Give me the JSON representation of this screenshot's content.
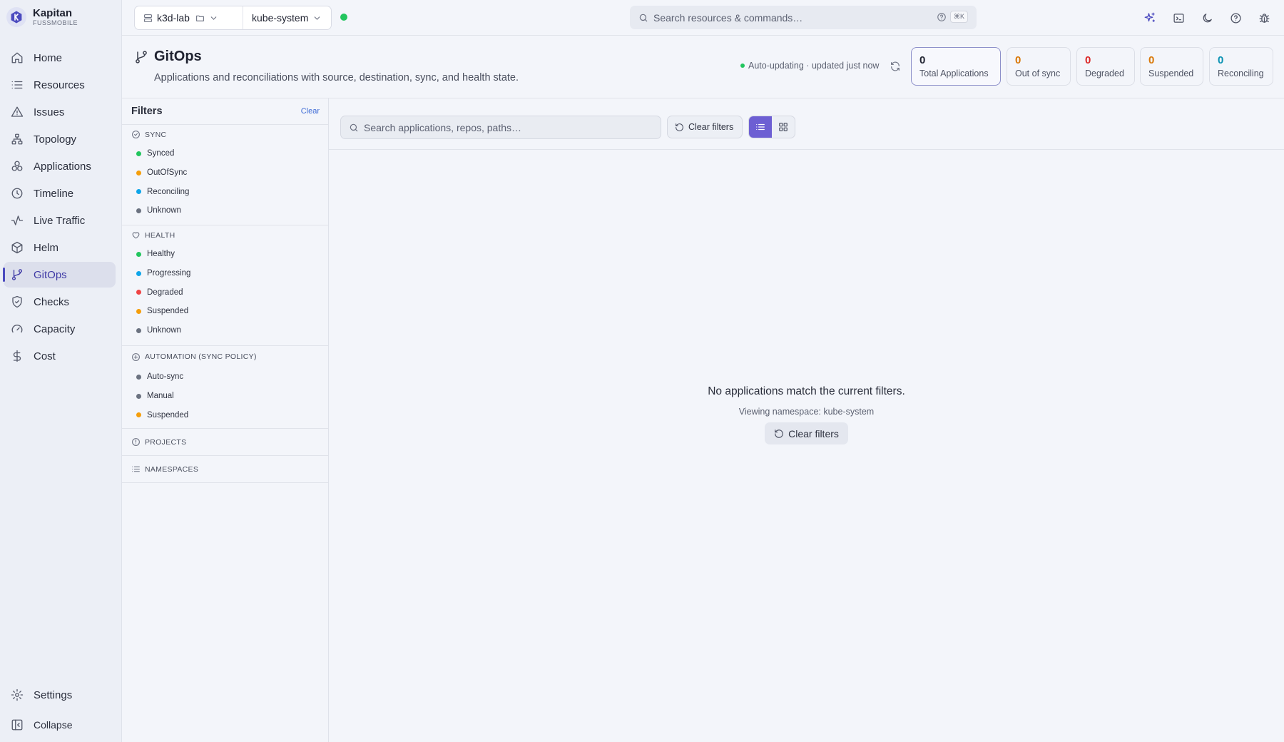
{
  "brand": {
    "name": "Kapitan",
    "subtitle": "FUSSMOBILE"
  },
  "nav": {
    "items": [
      {
        "label": "Home",
        "icon": "home-icon"
      },
      {
        "label": "Resources",
        "icon": "list-icon"
      },
      {
        "label": "Issues",
        "icon": "warning-icon"
      },
      {
        "label": "Topology",
        "icon": "topology-icon"
      },
      {
        "label": "Applications",
        "icon": "applications-icon"
      },
      {
        "label": "Timeline",
        "icon": "clock-icon"
      },
      {
        "label": "Live Traffic",
        "icon": "activity-icon"
      },
      {
        "label": "Helm",
        "icon": "package-icon"
      },
      {
        "label": "GitOps",
        "icon": "git-branch-icon",
        "active": true
      },
      {
        "label": "Checks",
        "icon": "shield-check-icon"
      },
      {
        "label": "Capacity",
        "icon": "gauge-icon"
      },
      {
        "label": "Cost",
        "icon": "dollar-icon"
      }
    ],
    "settings": "Settings",
    "collapse": "Collapse"
  },
  "topbar": {
    "cluster": "k3d-lab",
    "namespace": "kube-system",
    "connection_status_color": "#22c55e",
    "search_placeholder": "Search resources & commands…",
    "search_shortcut": "⌘K"
  },
  "header": {
    "title": "GitOps",
    "description": "Applications and reconciliations with source, destination, sync, and health state.",
    "auto_update_text": "Auto-updating · updated just now",
    "stats": [
      {
        "value": "0",
        "label": "Total Applications",
        "color": "#1f2230"
      },
      {
        "value": "0",
        "label": "Out of sync",
        "color": "#d97706"
      },
      {
        "value": "0",
        "label": "Degraded",
        "color": "#dc2626"
      },
      {
        "value": "0",
        "label": "Suspended",
        "color": "#d97706"
      },
      {
        "value": "0",
        "label": "Reconciling",
        "color": "#0891b2"
      }
    ]
  },
  "filters": {
    "title": "Filters",
    "clear": "Clear",
    "sync": {
      "title": "SYNC",
      "options": [
        {
          "label": "Synced",
          "color": "#22c55e"
        },
        {
          "label": "OutOfSync",
          "color": "#f59e0b"
        },
        {
          "label": "Reconciling",
          "color": "#0ea5e9"
        },
        {
          "label": "Unknown",
          "color": "#6b7280"
        }
      ]
    },
    "health": {
      "title": "HEALTH",
      "options": [
        {
          "label": "Healthy",
          "color": "#22c55e"
        },
        {
          "label": "Progressing",
          "color": "#0ea5e9"
        },
        {
          "label": "Degraded",
          "color": "#ef4444"
        },
        {
          "label": "Suspended",
          "color": "#f59e0b"
        },
        {
          "label": "Unknown",
          "color": "#6b7280"
        }
      ]
    },
    "automation": {
      "title": "AUTOMATION (SYNC POLICY)",
      "options": [
        {
          "label": "Auto-sync",
          "color": "#6b7280"
        },
        {
          "label": "Manual",
          "color": "#6b7280"
        },
        {
          "label": "Suspended",
          "color": "#f59e0b"
        }
      ]
    },
    "projects": {
      "title": "PROJECTS"
    },
    "namespaces": {
      "title": "NAMESPACES"
    }
  },
  "main": {
    "search_placeholder": "Search applications, repos, paths…",
    "clear_filters": "Clear filters",
    "empty_title": "No applications match the current filters.",
    "empty_subtitle": "Viewing namespace: kube-system",
    "empty_button": "Clear filters"
  }
}
